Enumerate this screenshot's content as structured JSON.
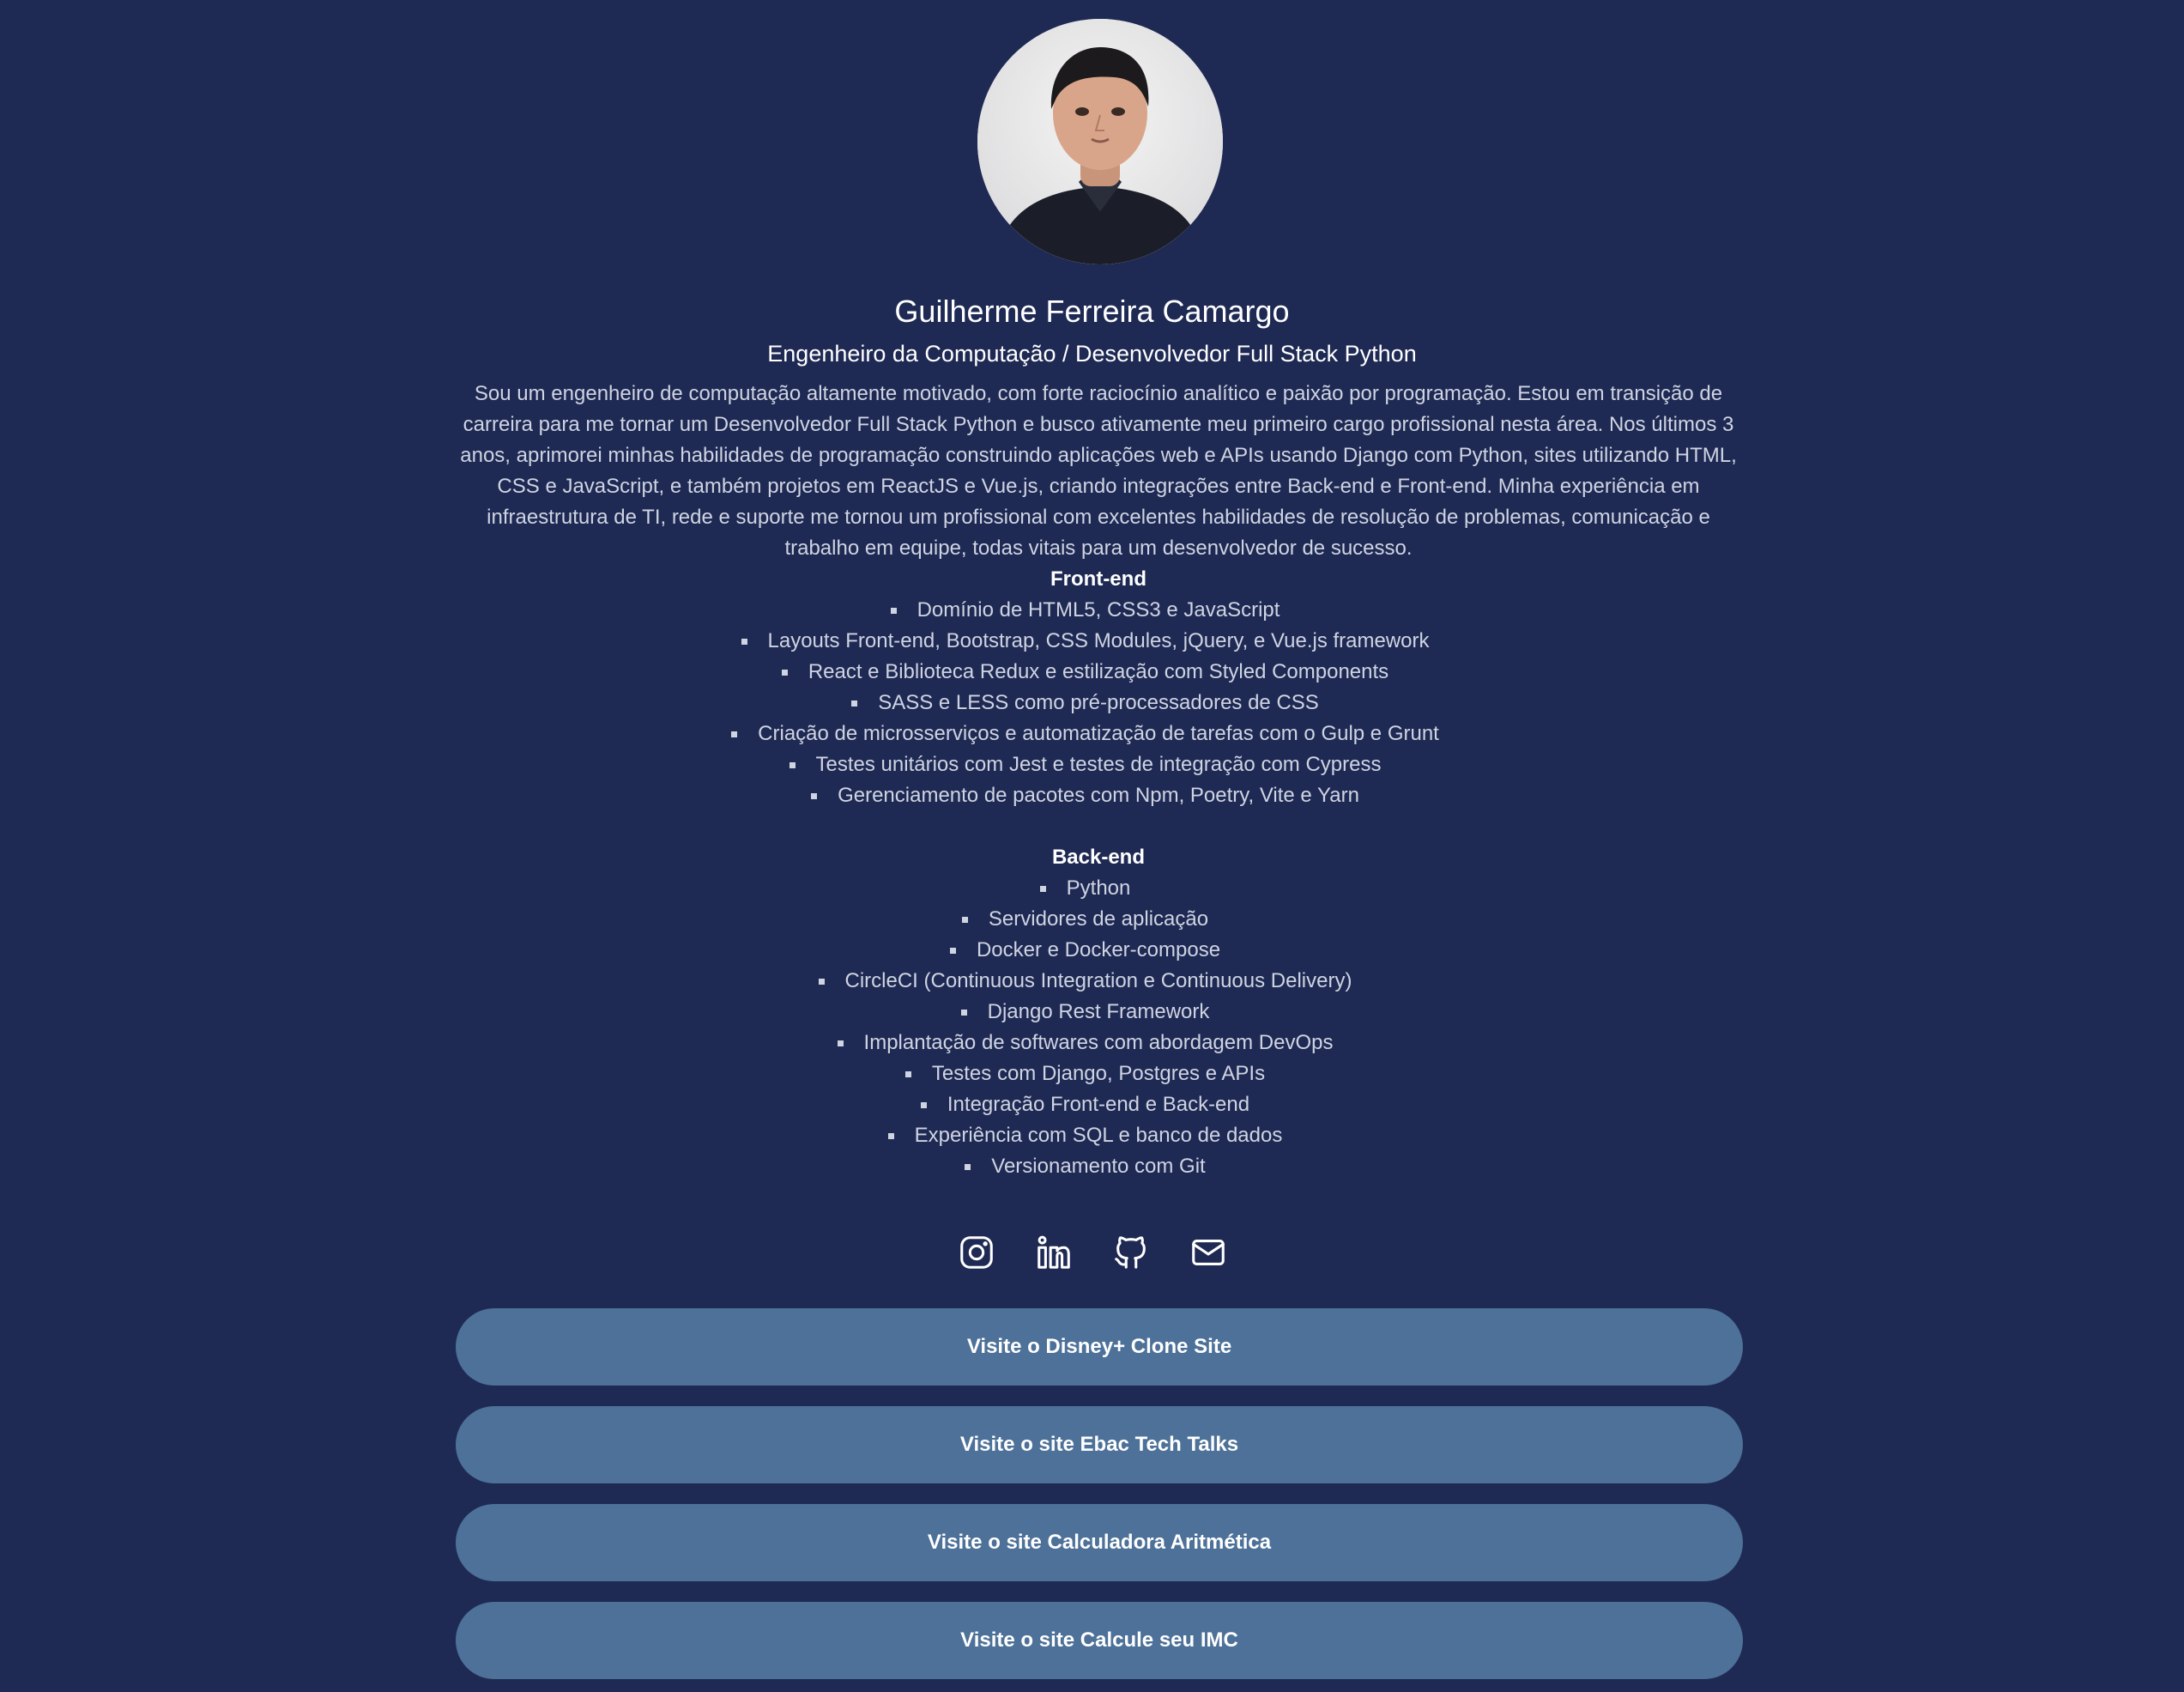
{
  "profile": {
    "name": "Guilherme Ferreira Camargo",
    "title": "Engenheiro da Computação / Desenvolvedor Full Stack Python",
    "bio": "Sou um engenheiro de computação altamente motivado, com forte raciocínio analítico e paixão por programação. Estou em transição de carreira para me tornar um Desenvolvedor Full Stack Python e busco ativamente meu primeiro cargo profissional nesta área. Nos últimos 3 anos, aprimorei minhas habilidades de programação construindo aplicações web e APIs usando Django com Python, sites utilizando HTML, CSS e JavaScript, e também projetos em ReactJS e Vue.js, criando integrações entre Back-end e Front-end. Minha experiência em infraestrutura de TI, rede e suporte me tornou um profissional com excelentes habilidades de resolução de problemas, comunicação e trabalho em equipe, todas vitais para um desenvolvedor de sucesso."
  },
  "frontend": {
    "title": "Front-end",
    "items": [
      "Domínio de HTML5, CSS3 e JavaScript",
      "Layouts Front-end, Bootstrap, CSS Modules, jQuery, e Vue.js framework",
      "React e Biblioteca Redux e estilização com Styled Components",
      "SASS e LESS como pré-processadores de CSS",
      "Criação de microsserviços e automatização de tarefas com o Gulp e Grunt",
      "Testes unitários com Jest e testes de integração com Cypress",
      "Gerenciamento de pacotes com Npm, Poetry, Vite e Yarn"
    ]
  },
  "backend": {
    "title": "Back-end",
    "items": [
      "Python",
      "Servidores de aplicação",
      "Docker e Docker-compose",
      "CircleCI (Continuous Integration e Continuous Delivery)",
      "Django Rest Framework",
      "Implantação de softwares com abordagem DevOps",
      "Testes com Django, Postgres e APIs",
      "Integração Front-end e Back-end",
      "Experiência com SQL e banco de dados",
      "Versionamento com Git"
    ]
  },
  "socials": [
    "instagram-icon",
    "linkedin-icon",
    "github-icon",
    "mail-icon"
  ],
  "links": [
    "Visite o Disney+ Clone Site",
    "Visite o site Ebac Tech Talks",
    "Visite o site Calculadora Aritmética",
    "Visite o site Calcule seu IMC"
  ],
  "colors": {
    "background": "#1f2a54",
    "button": "#4d7198",
    "text": "#cfd4e2",
    "heading": "#ffffff"
  }
}
